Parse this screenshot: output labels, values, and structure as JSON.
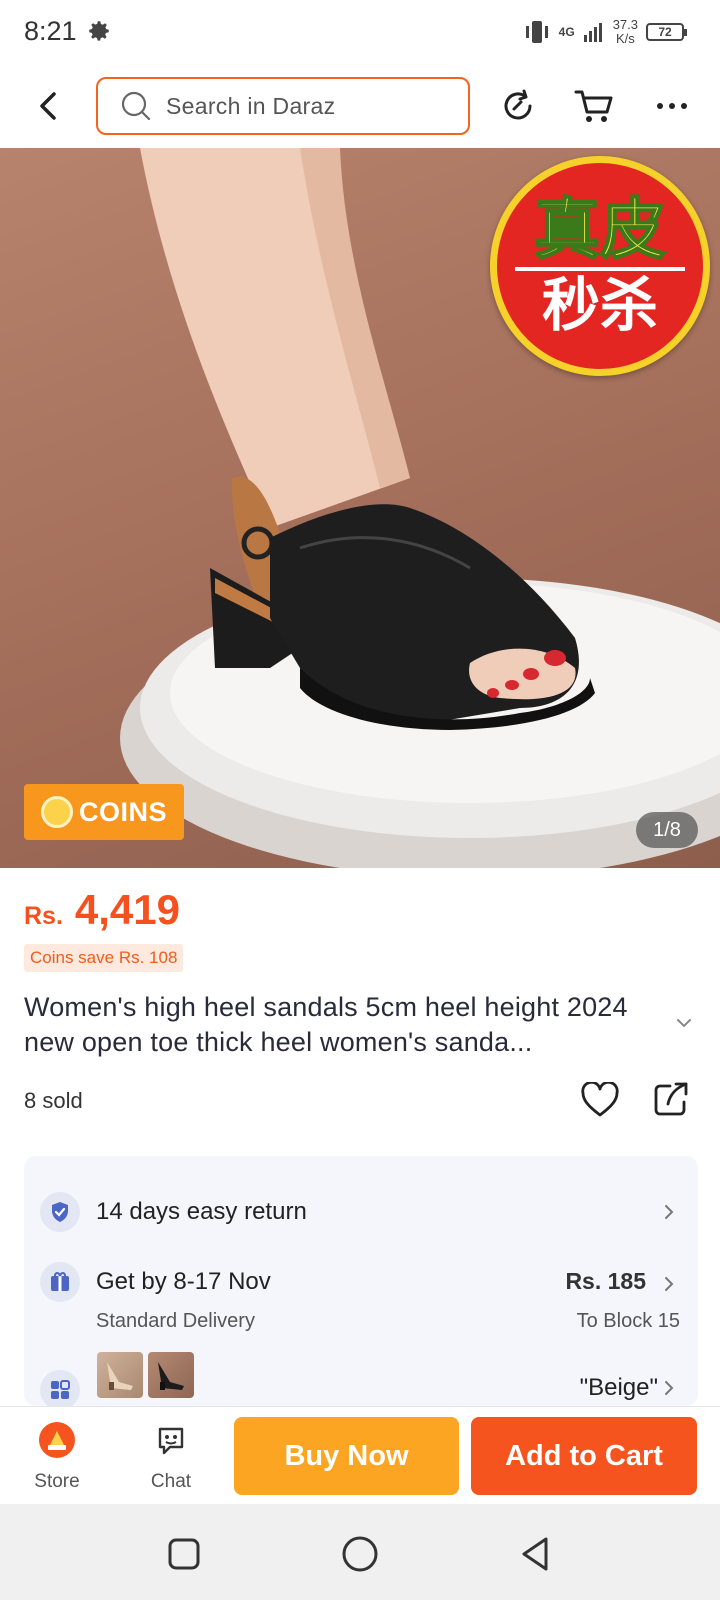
{
  "status_bar": {
    "time": "8:21",
    "network": "4G",
    "speed_value": "37.3",
    "speed_unit": "K/s",
    "battery": "72"
  },
  "header": {
    "search_placeholder": "Search in Daraz",
    "icons": [
      "back-icon",
      "search-icon",
      "refresh-icon",
      "cart-icon",
      "more-icon"
    ]
  },
  "gallery": {
    "seal_text_top": "真皮",
    "seal_text_bottom": "秒杀",
    "coins_badge": "COINS",
    "counter": "1/8"
  },
  "product": {
    "currency": "Rs.",
    "price": "4,419",
    "coins_save": "Coins save Rs. 108",
    "title": "Women's high heel sandals 5cm heel height 2024 new open toe thick heel women's sanda...",
    "sold": "8 sold"
  },
  "info": {
    "returns": "14 days easy return",
    "delivery_title": "Get by 8-17 Nov",
    "delivery_sub": "Standard Delivery",
    "delivery_fee": "Rs. 185",
    "delivery_to": "To Block 15",
    "variant_label": "\"Beige\""
  },
  "actions": {
    "store": "Store",
    "chat": "Chat",
    "buy_now": "Buy Now",
    "add_to_cart": "Add to Cart"
  },
  "colors": {
    "brand_orange": "#f5541e",
    "buy_yellow": "#fca522",
    "price_orange": "#f5501e"
  }
}
